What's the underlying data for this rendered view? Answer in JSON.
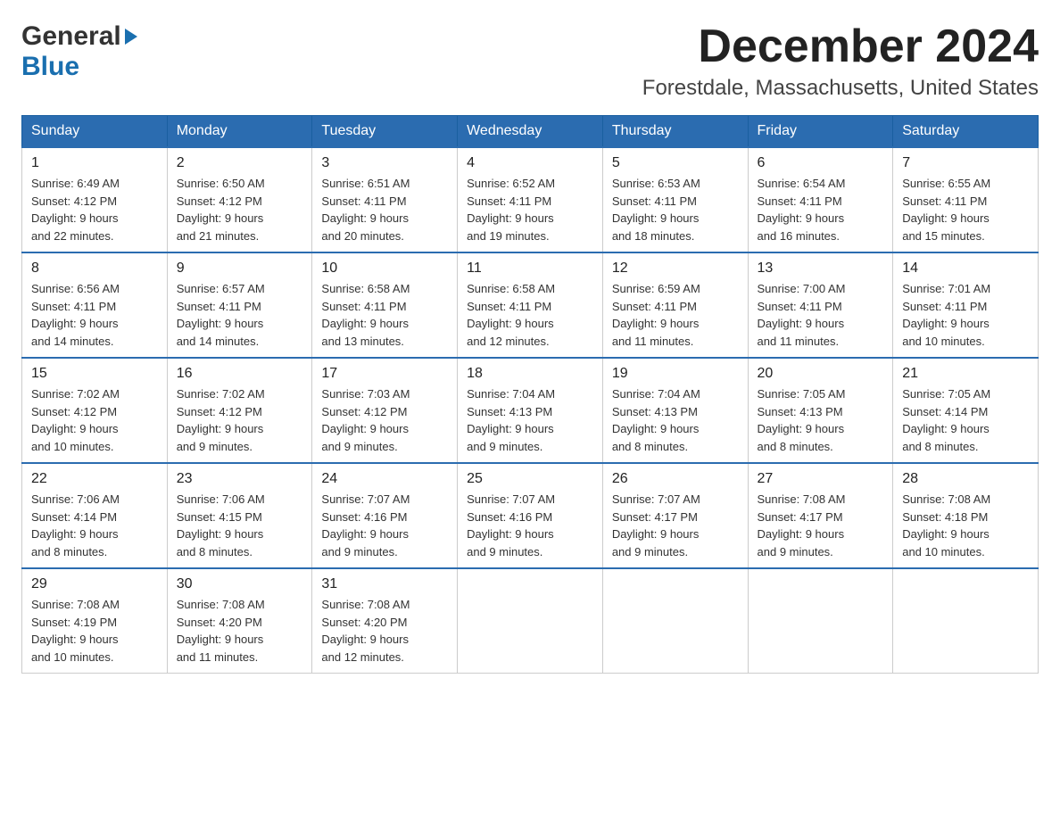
{
  "header": {
    "logo_general": "General",
    "logo_blue": "Blue",
    "title": "December 2024",
    "subtitle": "Forestdale, Massachusetts, United States"
  },
  "days_of_week": [
    "Sunday",
    "Monday",
    "Tuesday",
    "Wednesday",
    "Thursday",
    "Friday",
    "Saturday"
  ],
  "weeks": [
    [
      {
        "num": "1",
        "sunrise": "6:49 AM",
        "sunset": "4:12 PM",
        "daylight": "9 hours and 22 minutes."
      },
      {
        "num": "2",
        "sunrise": "6:50 AM",
        "sunset": "4:12 PM",
        "daylight": "9 hours and 21 minutes."
      },
      {
        "num": "3",
        "sunrise": "6:51 AM",
        "sunset": "4:11 PM",
        "daylight": "9 hours and 20 minutes."
      },
      {
        "num": "4",
        "sunrise": "6:52 AM",
        "sunset": "4:11 PM",
        "daylight": "9 hours and 19 minutes."
      },
      {
        "num": "5",
        "sunrise": "6:53 AM",
        "sunset": "4:11 PM",
        "daylight": "9 hours and 18 minutes."
      },
      {
        "num": "6",
        "sunrise": "6:54 AM",
        "sunset": "4:11 PM",
        "daylight": "9 hours and 16 minutes."
      },
      {
        "num": "7",
        "sunrise": "6:55 AM",
        "sunset": "4:11 PM",
        "daylight": "9 hours and 15 minutes."
      }
    ],
    [
      {
        "num": "8",
        "sunrise": "6:56 AM",
        "sunset": "4:11 PM",
        "daylight": "9 hours and 14 minutes."
      },
      {
        "num": "9",
        "sunrise": "6:57 AM",
        "sunset": "4:11 PM",
        "daylight": "9 hours and 14 minutes."
      },
      {
        "num": "10",
        "sunrise": "6:58 AM",
        "sunset": "4:11 PM",
        "daylight": "9 hours and 13 minutes."
      },
      {
        "num": "11",
        "sunrise": "6:58 AM",
        "sunset": "4:11 PM",
        "daylight": "9 hours and 12 minutes."
      },
      {
        "num": "12",
        "sunrise": "6:59 AM",
        "sunset": "4:11 PM",
        "daylight": "9 hours and 11 minutes."
      },
      {
        "num": "13",
        "sunrise": "7:00 AM",
        "sunset": "4:11 PM",
        "daylight": "9 hours and 11 minutes."
      },
      {
        "num": "14",
        "sunrise": "7:01 AM",
        "sunset": "4:11 PM",
        "daylight": "9 hours and 10 minutes."
      }
    ],
    [
      {
        "num": "15",
        "sunrise": "7:02 AM",
        "sunset": "4:12 PM",
        "daylight": "9 hours and 10 minutes."
      },
      {
        "num": "16",
        "sunrise": "7:02 AM",
        "sunset": "4:12 PM",
        "daylight": "9 hours and 9 minutes."
      },
      {
        "num": "17",
        "sunrise": "7:03 AM",
        "sunset": "4:12 PM",
        "daylight": "9 hours and 9 minutes."
      },
      {
        "num": "18",
        "sunrise": "7:04 AM",
        "sunset": "4:13 PM",
        "daylight": "9 hours and 9 minutes."
      },
      {
        "num": "19",
        "sunrise": "7:04 AM",
        "sunset": "4:13 PM",
        "daylight": "9 hours and 8 minutes."
      },
      {
        "num": "20",
        "sunrise": "7:05 AM",
        "sunset": "4:13 PM",
        "daylight": "9 hours and 8 minutes."
      },
      {
        "num": "21",
        "sunrise": "7:05 AM",
        "sunset": "4:14 PM",
        "daylight": "9 hours and 8 minutes."
      }
    ],
    [
      {
        "num": "22",
        "sunrise": "7:06 AM",
        "sunset": "4:14 PM",
        "daylight": "9 hours and 8 minutes."
      },
      {
        "num": "23",
        "sunrise": "7:06 AM",
        "sunset": "4:15 PM",
        "daylight": "9 hours and 8 minutes."
      },
      {
        "num": "24",
        "sunrise": "7:07 AM",
        "sunset": "4:16 PM",
        "daylight": "9 hours and 9 minutes."
      },
      {
        "num": "25",
        "sunrise": "7:07 AM",
        "sunset": "4:16 PM",
        "daylight": "9 hours and 9 minutes."
      },
      {
        "num": "26",
        "sunrise": "7:07 AM",
        "sunset": "4:17 PM",
        "daylight": "9 hours and 9 minutes."
      },
      {
        "num": "27",
        "sunrise": "7:08 AM",
        "sunset": "4:17 PM",
        "daylight": "9 hours and 9 minutes."
      },
      {
        "num": "28",
        "sunrise": "7:08 AM",
        "sunset": "4:18 PM",
        "daylight": "9 hours and 10 minutes."
      }
    ],
    [
      {
        "num": "29",
        "sunrise": "7:08 AM",
        "sunset": "4:19 PM",
        "daylight": "9 hours and 10 minutes."
      },
      {
        "num": "30",
        "sunrise": "7:08 AM",
        "sunset": "4:20 PM",
        "daylight": "9 hours and 11 minutes."
      },
      {
        "num": "31",
        "sunrise": "7:08 AM",
        "sunset": "4:20 PM",
        "daylight": "9 hours and 12 minutes."
      },
      null,
      null,
      null,
      null
    ]
  ],
  "labels": {
    "sunrise": "Sunrise:",
    "sunset": "Sunset:",
    "daylight": "Daylight:"
  }
}
